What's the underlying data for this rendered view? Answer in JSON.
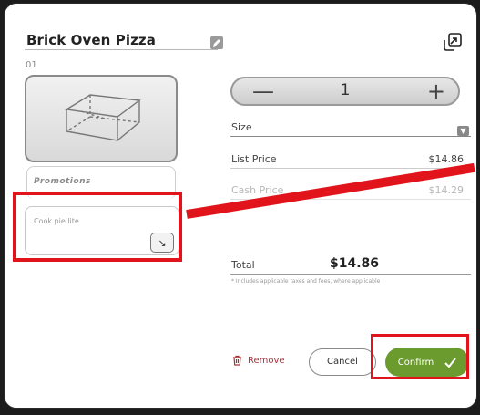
{
  "item": {
    "title": "Brick Oven Pizza",
    "number": "01"
  },
  "promotions": {
    "label": "Promotions"
  },
  "note": {
    "placeholder": "Cook pie lite"
  },
  "quantity": {
    "minus": "—",
    "value": "1",
    "plus": "+"
  },
  "size": {
    "label": "Size"
  },
  "pricing": {
    "list_label": "List Price",
    "list_value": "$14.86",
    "cash_label": "Cash Price",
    "cash_value": "$14.29",
    "total_label": "Total",
    "total_value": "$14.86",
    "tax_note": "* Includes applicable taxes and fees, where applicable"
  },
  "actions": {
    "remove_label": "Remove",
    "cancel_label": "Cancel",
    "confirm_label": "Confirm"
  },
  "colors": {
    "highlight": "#e1141b",
    "confirm": "#6b9a2e",
    "remove": "#b0303a"
  }
}
